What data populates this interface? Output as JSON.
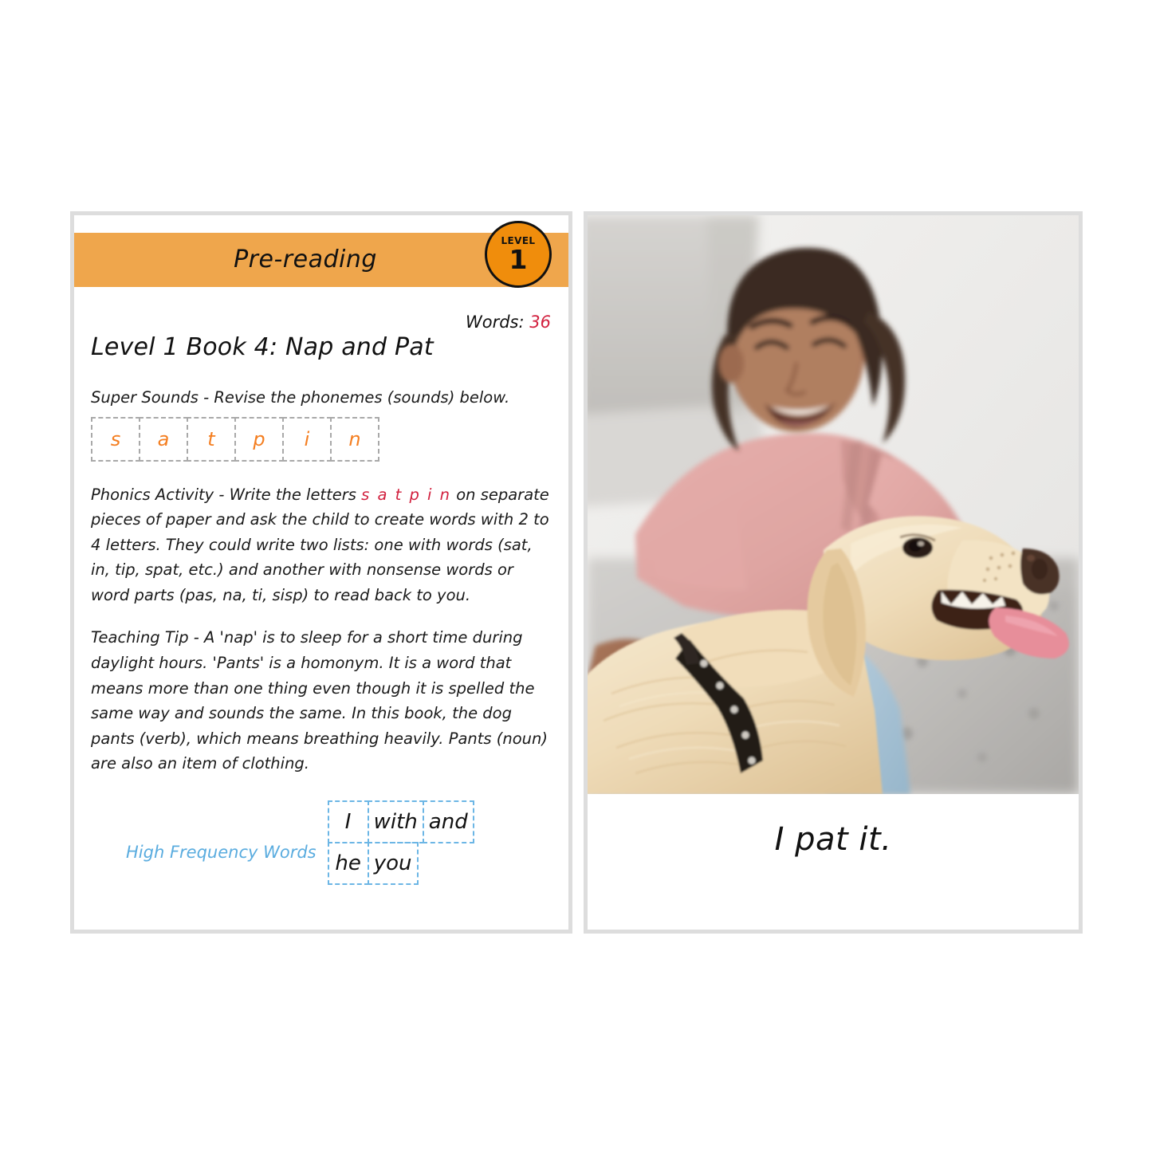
{
  "left_page": {
    "banner_title": "Pre-reading",
    "level_badge": {
      "word": "LEVEL",
      "number": "1"
    },
    "words_label": "Words:",
    "words_value": "36",
    "book_title": "Level 1 Book 4: Nap and Pat",
    "super_sounds_label": "Super Sounds - Revise the phonemes (sounds) below.",
    "phonemes": [
      "s",
      "a",
      "t",
      "p",
      "i",
      "n"
    ],
    "phonics_activity": {
      "before": "Phonics Activity - Write the letters ",
      "letters": "s a t p i n",
      "after": " on separate pieces of paper and ask the child to create words with 2 to 4 letters. They could write two lists: one with words (sat, in, tip, spat, etc.) and another with nonsense words or word parts (pas, na, ti, sisp) to read back to you."
    },
    "teaching_tip": "Teaching Tip - A 'nap' is to sleep for a short time during daylight hours. 'Pants' is a homonym. It is a word that means more than one thing even though it is spelled the same way and sounds the same. In this book, the dog pants (verb), which means breathing heavily. Pants (noun) are also an item of clothing.",
    "high_frequency_words_label": "High Frequency Words",
    "high_frequency_words": [
      [
        "I",
        "with",
        "and"
      ],
      [
        "he",
        "you"
      ]
    ]
  },
  "right_page": {
    "photo_description": "girl-petting-golden-retriever-photo",
    "caption": "I pat it."
  },
  "colors": {
    "banner_orange": "#efa64c",
    "badge_orange": "#f08d0c",
    "phoneme_orange": "#f47e20",
    "accent_red": "#d2213f",
    "hfw_blue": "#5aacdf",
    "hfw_border_blue": "#6cb6e5",
    "page_border_gray": "#dddddd",
    "phoneme_border_gray": "#a9a9a9"
  }
}
